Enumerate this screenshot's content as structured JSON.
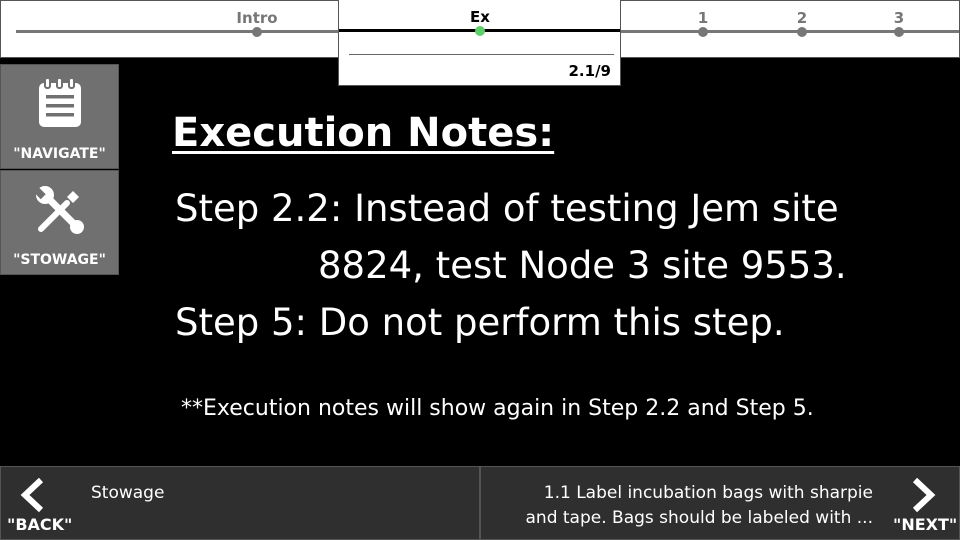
{
  "progress": {
    "stages": [
      {
        "label": "Intro"
      },
      {
        "label": "Ex"
      },
      {
        "label": "1"
      },
      {
        "label": "2"
      },
      {
        "label": "3"
      }
    ],
    "active_stage": "Ex",
    "substep_counter": "2.1/9",
    "active_color": "#5fcf6a"
  },
  "side": {
    "navigate_label": "\"NAVIGATE\"",
    "navigate_icon": "clipboard-icon",
    "stowage_label": "\"STOWAGE\"",
    "stowage_icon": "tools-icon"
  },
  "main": {
    "title": "Execution Notes:",
    "note1_line1": "Step 2.2: Instead of testing Jem site",
    "note1_line2": "8824, test Node 3 site 9553.",
    "note2": "Step 5: Do not perform this step.",
    "footnote": "**Execution notes will show again in Step 2.2 and Step 5."
  },
  "bottom": {
    "back_label": "\"BACK\"",
    "back_preview": "Stowage",
    "next_label": "\"NEXT\"",
    "next_preview_line1": "1.1 Label incubation bags with sharpie",
    "next_preview_line2": "and tape. Bags should be labeled with ..."
  }
}
